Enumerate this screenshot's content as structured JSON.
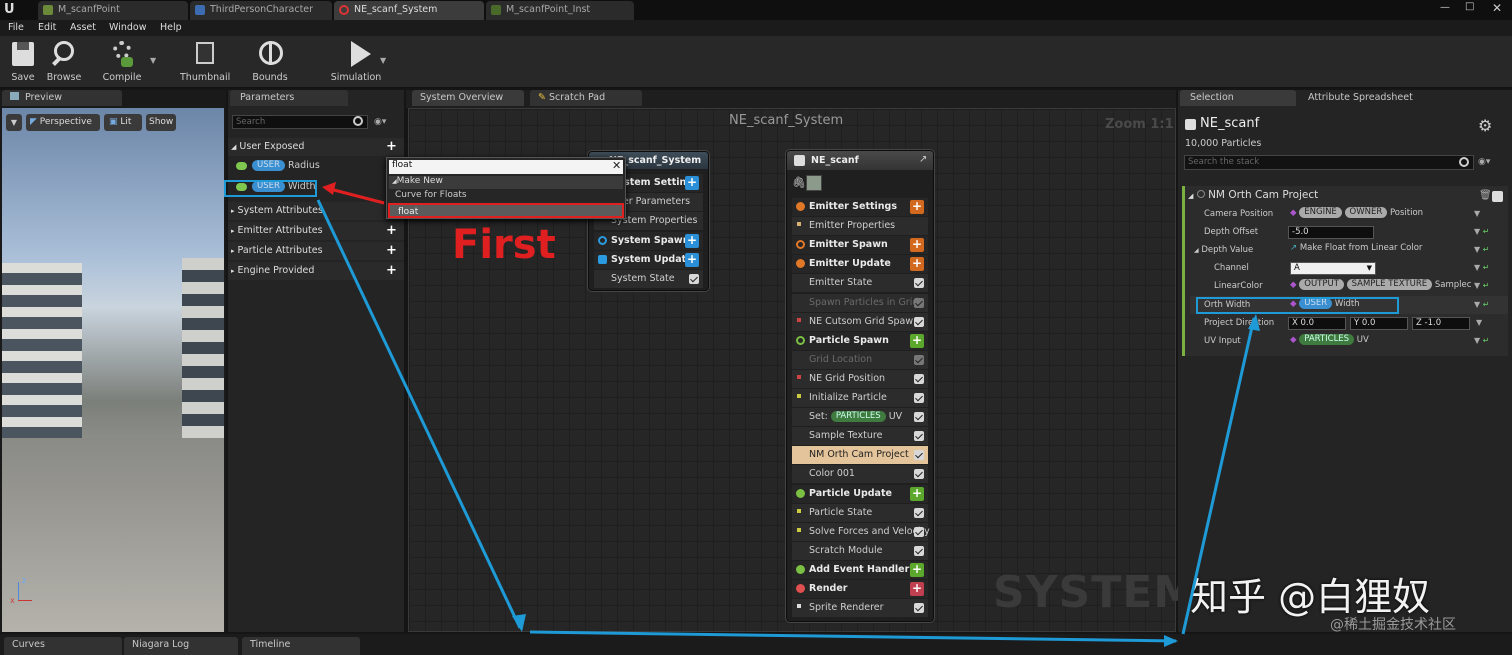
{
  "tabs": [
    "M_scanfPoint",
    "ThirdPersonCharacter",
    "NE_scanf_System",
    "M_scanfPoint_Inst"
  ],
  "menu": [
    "File",
    "Edit",
    "Asset",
    "Window",
    "Help"
  ],
  "toolbar": {
    "save": "Save",
    "browse": "Browse",
    "compile": "Compile",
    "thumbnail": "Thumbnail",
    "bounds": "Bounds",
    "simulation": "Simulation"
  },
  "preview": {
    "tab": "Preview",
    "perspective": "Perspective",
    "lit": "Lit",
    "show": "Show"
  },
  "parameters": {
    "tab": "Parameters",
    "search_placeholder": "Search",
    "user_exposed": "User Exposed",
    "radius_badge": "USER",
    "radius": "Radius",
    "width_badge": "USER",
    "width": "Width",
    "system_attributes": "System Attributes",
    "emitter_attributes": "Emitter Attributes",
    "particle_attributes": "Particle Attributes",
    "engine_provided": "Engine Provided"
  },
  "popup": {
    "query": "float",
    "make_new": "Make New",
    "curve": "Curve for Floats",
    "float": "float"
  },
  "annotation": {
    "first": "First"
  },
  "graph": {
    "tab_overview": "System Overview",
    "tab_scratch": "Scratch Pad",
    "title": "NE_scanf_System",
    "zoom": "Zoom 1:1",
    "watermark": "SYSTEM",
    "system_node": {
      "title": "NE_scanf_System",
      "rows": [
        "System Settings",
        "User Parameters",
        "System Properties",
        "System Spawn",
        "System Update",
        "System State"
      ]
    },
    "emitter_node": {
      "title": "NE_scanf",
      "rows": [
        "Emitter Settings",
        "Emitter Properties",
        "Emitter Spawn",
        "Emitter Update",
        "Emitter State",
        "Spawn Particles in Grid",
        "NE Cutsom Grid Spawn",
        "Particle Spawn",
        "Grid Location",
        "NE Grid Position",
        "Initialize Particle",
        "Set:",
        "Sample Texture",
        "NM Orth Cam Project",
        "Color 001",
        "Particle Update",
        "Particle State",
        "Solve Forces and Velocity",
        "Scratch Module",
        "Add Event Handler",
        "Render",
        "Sprite Renderer"
      ],
      "set_badge": "PARTICLES",
      "set_suffix": "UV"
    }
  },
  "selection": {
    "tab": "Selection",
    "tab2": "Attribute Spreadsheet",
    "name": "NE_scanf",
    "particles": "10,000 Particles",
    "search_placeholder": "Search the stack",
    "module": "NM Orth Cam Project",
    "rows": {
      "camera_position": {
        "label": "Camera Position",
        "b1": "ENGINE",
        "b2": "OWNER",
        "text": "Position"
      },
      "depth_offset": {
        "label": "Depth Offset",
        "value": "-5.0"
      },
      "depth_value": {
        "label": "Depth Value",
        "text": "Make Float from Linear Color"
      },
      "channel": {
        "label": "Channel",
        "value": "A"
      },
      "linear_color": {
        "label": "LinearColor",
        "b1": "OUTPUT",
        "b2": "SAMPLE TEXTURE",
        "text": "Samplec"
      },
      "orth_width": {
        "label": "Orth Width",
        "badge": "USER",
        "text": "Width"
      },
      "project_direction": {
        "label": "Project Direction",
        "x": "X 0.0",
        "y": "Y 0.0",
        "z": "Z -1.0"
      },
      "uv_input": {
        "label": "UV Input",
        "badge": "PARTICLES",
        "text": "UV"
      }
    }
  },
  "bottom_tabs": [
    "Curves",
    "Niagara Log",
    "Timeline"
  ],
  "watermark": {
    "main": "知乎 @白狸奴",
    "sub": "@稀土掘金技术社区"
  },
  "colors": {
    "accent_blue": "#1e9ad6",
    "annotation_red": "#e02020",
    "user_badge": "#3a8fd0",
    "green_plus": "#5ba82c",
    "orange_plus": "#d2691e",
    "blue_plus": "#2a8fd6"
  }
}
